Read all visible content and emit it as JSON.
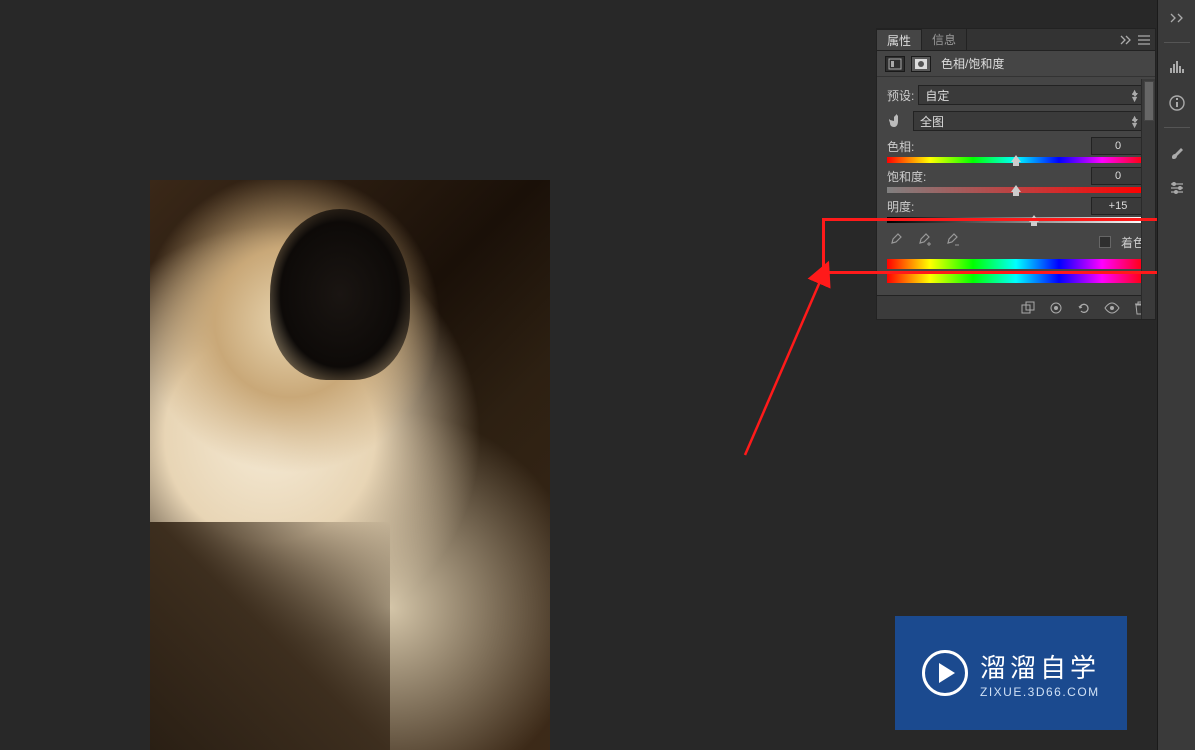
{
  "tabs": {
    "properties": "属性",
    "info": "信息"
  },
  "panel": {
    "title": "色相/饱和度",
    "preset_label": "预设:",
    "preset_value": "自定",
    "range_value": "全图",
    "hue_label": "色相:",
    "hue_value": "0",
    "sat_label": "饱和度:",
    "sat_value": "0",
    "light_label": "明度:",
    "light_value": "+15",
    "colorize_label": "着色"
  },
  "watermark": {
    "title": "溜溜自学",
    "sub": "ZIXUE.3D66.COM"
  },
  "icons": {
    "histogram": "histogram-icon",
    "adjust": "adjustment-icon",
    "hand": "hand-icon",
    "eyedrop": "eyedropper-icon",
    "eyedrop_plus": "eyedropper-plus-icon",
    "eyedrop_minus": "eyedropper-minus-icon",
    "clip": "clip-to-layer-icon",
    "prev": "view-previous-icon",
    "reset": "reset-icon",
    "eye": "visibility-icon",
    "trash": "delete-icon",
    "collapse": "collapse-icon",
    "menu": "panel-menu-icon"
  },
  "colors": {
    "accent_highlight": "#ff1a1a",
    "panel_bg": "#454545",
    "watermark_bg": "#1b4a8f"
  }
}
